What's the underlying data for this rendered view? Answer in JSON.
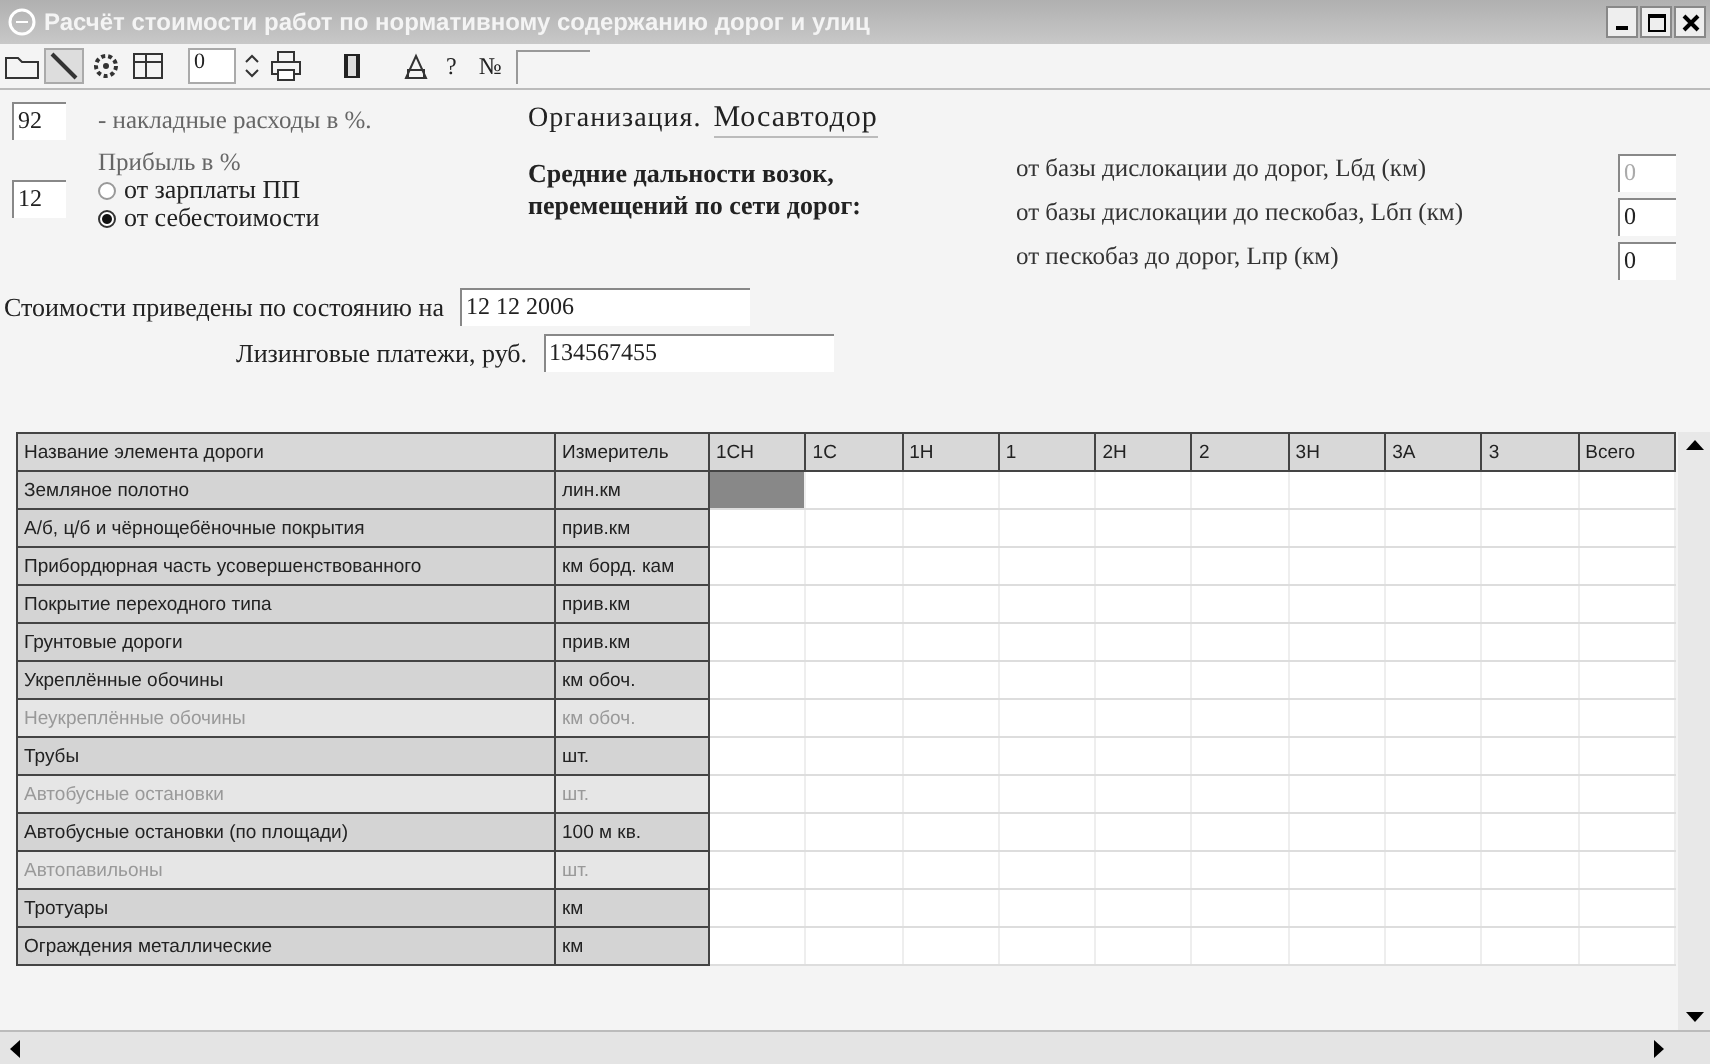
{
  "window": {
    "title": "Расчёт стоимости работ по нормативному содержанию дорог и улиц"
  },
  "toolbar": {
    "spin_value": "0",
    "help": "?",
    "number_label": "№"
  },
  "form": {
    "overhead": {
      "value": "92",
      "label": "- накладные расходы в %."
    },
    "profit": {
      "value": "12",
      "label": "Прибыль в %",
      "options": [
        {
          "label": "от зарплаты ПП",
          "selected": false
        },
        {
          "label": "от себестоимости",
          "selected": true
        }
      ]
    },
    "organization": {
      "label": "Организация.",
      "value": "Мосавтодор"
    },
    "distances": {
      "label_1": "Средние дальности возок,",
      "label_2": "перемещений по сети дорог:",
      "items": [
        {
          "label": "от базы дислокации до дорог, Lбд (км)",
          "value": "0",
          "disabled": true
        },
        {
          "label": "от базы дислокации до пескобаз, Lбп (км)",
          "value": "0",
          "disabled": false
        },
        {
          "label": "от пескобаз до дорог, Lпр (км)",
          "value": "0",
          "disabled": false
        }
      ]
    },
    "date": {
      "label": "Стоимости приведены по состоянию на",
      "value": "12 12 2006"
    },
    "leasing": {
      "label": "Лизинговые платежи, руб.",
      "value": "134567455"
    }
  },
  "table": {
    "columns": [
      "Название элемента дороги",
      "Измеритель",
      "1СН",
      "1С",
      "1Н",
      "1",
      "2Н",
      "2",
      "3Н",
      "3А",
      "3",
      "Всего"
    ],
    "rows": [
      {
        "name": "Земляное полотно",
        "unit": "лин.км",
        "disabled": false,
        "selected": true
      },
      {
        "name": "А/б, ц/б и чёрнощебёночные покрытия",
        "unit": "прив.км",
        "disabled": false,
        "selected": false
      },
      {
        "name": "Прибордюрная часть усовершенствованного",
        "unit": "км борд. кам",
        "disabled": false,
        "selected": false
      },
      {
        "name": "Покрытие переходного типа",
        "unit": "прив.км",
        "disabled": false,
        "selected": false
      },
      {
        "name": "Грунтовые дороги",
        "unit": "прив.км",
        "disabled": false,
        "selected": false
      },
      {
        "name": "Укреплённые обочины",
        "unit": "км обоч.",
        "disabled": false,
        "selected": false
      },
      {
        "name": "Неукреплённые обочины",
        "unit": "км обоч.",
        "disabled": true,
        "selected": false
      },
      {
        "name": "Трубы",
        "unit": "шт.",
        "disabled": false,
        "selected": false
      },
      {
        "name": "Автобусные остановки",
        "unit": "шт.",
        "disabled": true,
        "selected": false
      },
      {
        "name": "Автобусные остановки (по площади)",
        "unit": "100 м кв.",
        "disabled": false,
        "selected": false
      },
      {
        "name": "Автопавильоны",
        "unit": "шт.",
        "disabled": true,
        "selected": false
      },
      {
        "name": "Тротуары",
        "unit": "км",
        "disabled": false,
        "selected": false
      },
      {
        "name": "Ограждения металлические",
        "unit": "км",
        "disabled": false,
        "selected": false
      }
    ]
  }
}
